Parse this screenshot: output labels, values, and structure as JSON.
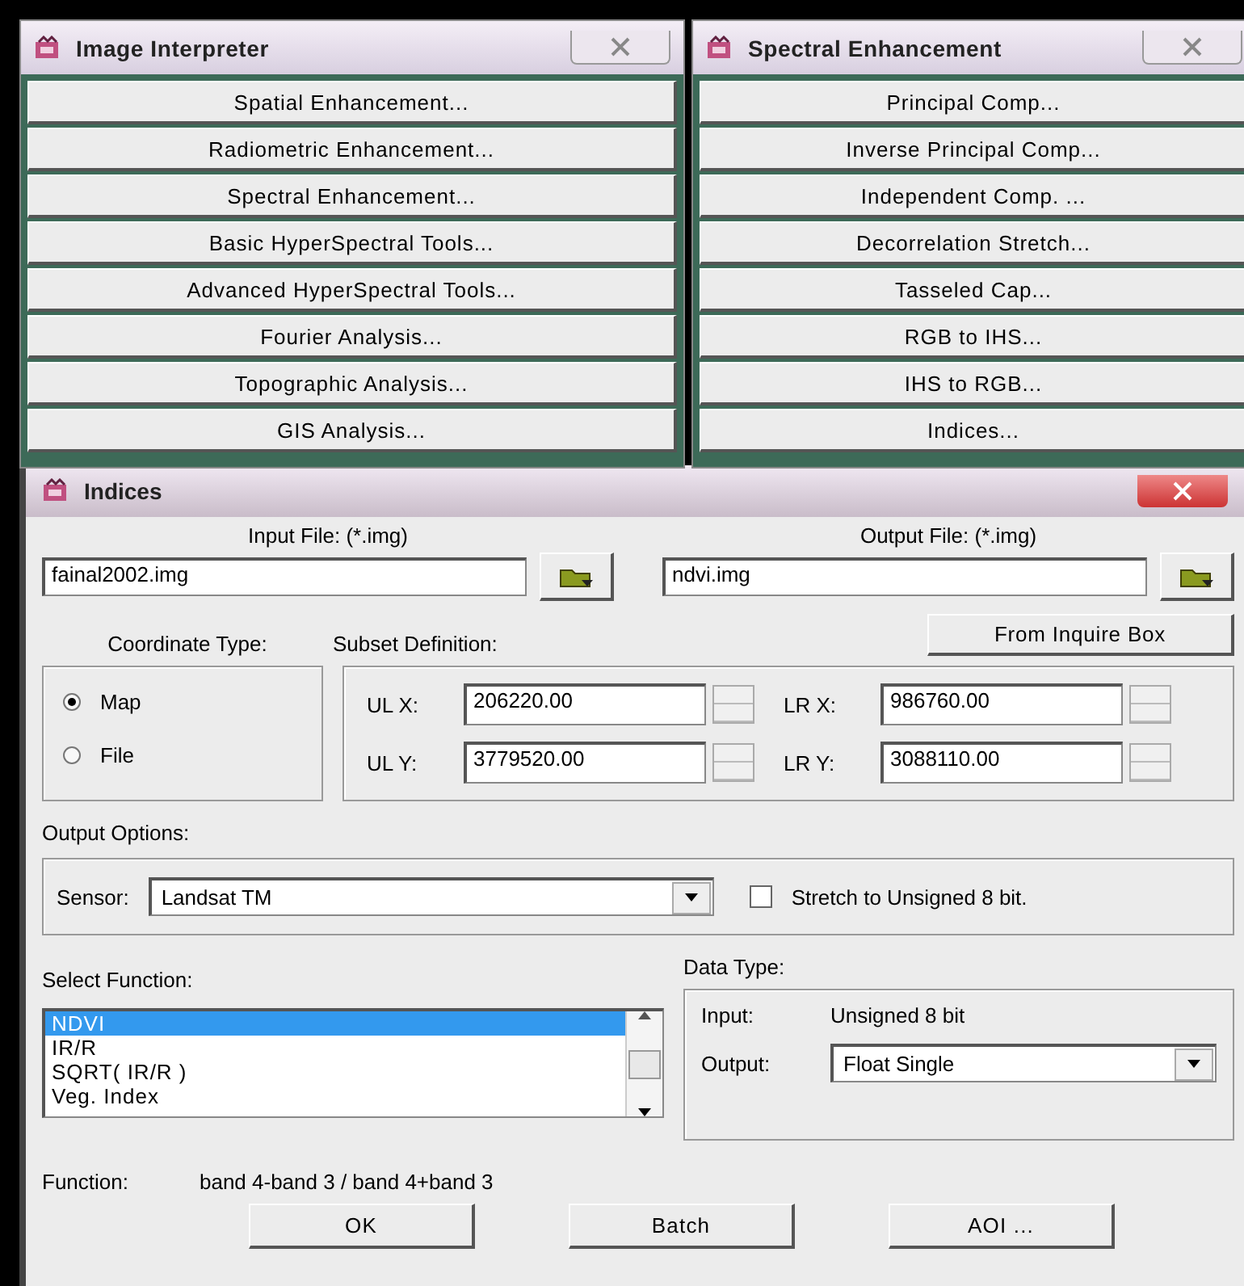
{
  "windows": [
    {
      "title": "Image Interpreter",
      "buttons": [
        "Spatial Enhancement...",
        "Radiometric Enhancement...",
        "Spectral Enhancement...",
        "Basic HyperSpectral Tools...",
        "Advanced HyperSpectral Tools...",
        "Fourier Analysis...",
        "Topographic Analysis...",
        "GIS Analysis..."
      ]
    },
    {
      "title": "Spectral Enhancement",
      "buttons": [
        "Principal Comp...",
        "Inverse Principal Comp...",
        "Independent Comp. ...",
        "Decorrelation Stretch...",
        "Tasseled Cap...",
        "RGB to IHS...",
        "IHS to RGB...",
        "Indices..."
      ]
    }
  ],
  "dialog": {
    "title": "Indices",
    "input_file": {
      "label": "Input File: (*.img)",
      "value": "fainal2002.img"
    },
    "output_file": {
      "label": "Output File: (*.img)",
      "value": "ndvi.img"
    },
    "coordinate_type": {
      "label": "Coordinate Type:",
      "options": [
        {
          "label": "Map",
          "selected": true
        },
        {
          "label": "File",
          "selected": false
        }
      ]
    },
    "subset": {
      "label": "Subset Definition:",
      "button": "From Inquire Box",
      "fields": [
        {
          "label": "UL X:",
          "value": "206220.00"
        },
        {
          "label": "LR X:",
          "value": "986760.00"
        },
        {
          "label": "UL Y:",
          "value": "3779520.00"
        },
        {
          "label": "LR Y:",
          "value": "3088110.00"
        }
      ]
    },
    "output_options": {
      "label": "Output Options:",
      "sensor_label": "Sensor:",
      "sensor": "Landsat TM",
      "stretch": {
        "label": "Stretch to Unsigned 8 bit.",
        "checked": false
      }
    },
    "select_function": {
      "label": "Select Function:",
      "items": [
        {
          "label": "NDVI",
          "selected": true
        },
        {
          "label": "IR/R",
          "selected": false
        },
        {
          "label": "SQRT( IR/R )",
          "selected": false
        },
        {
          "label": "Veg. Index",
          "selected": false
        }
      ]
    },
    "data_type": {
      "label": "Data Type:",
      "input_label": "Input:",
      "input_value": "Unsigned 8 bit",
      "output_label": "Output:",
      "output_value": "Float Single"
    },
    "function": {
      "label": "Function:",
      "value": "band 4-band 3 / band 4+band 3"
    },
    "buttons": [
      "OK",
      "Batch",
      "AOI ..."
    ]
  }
}
